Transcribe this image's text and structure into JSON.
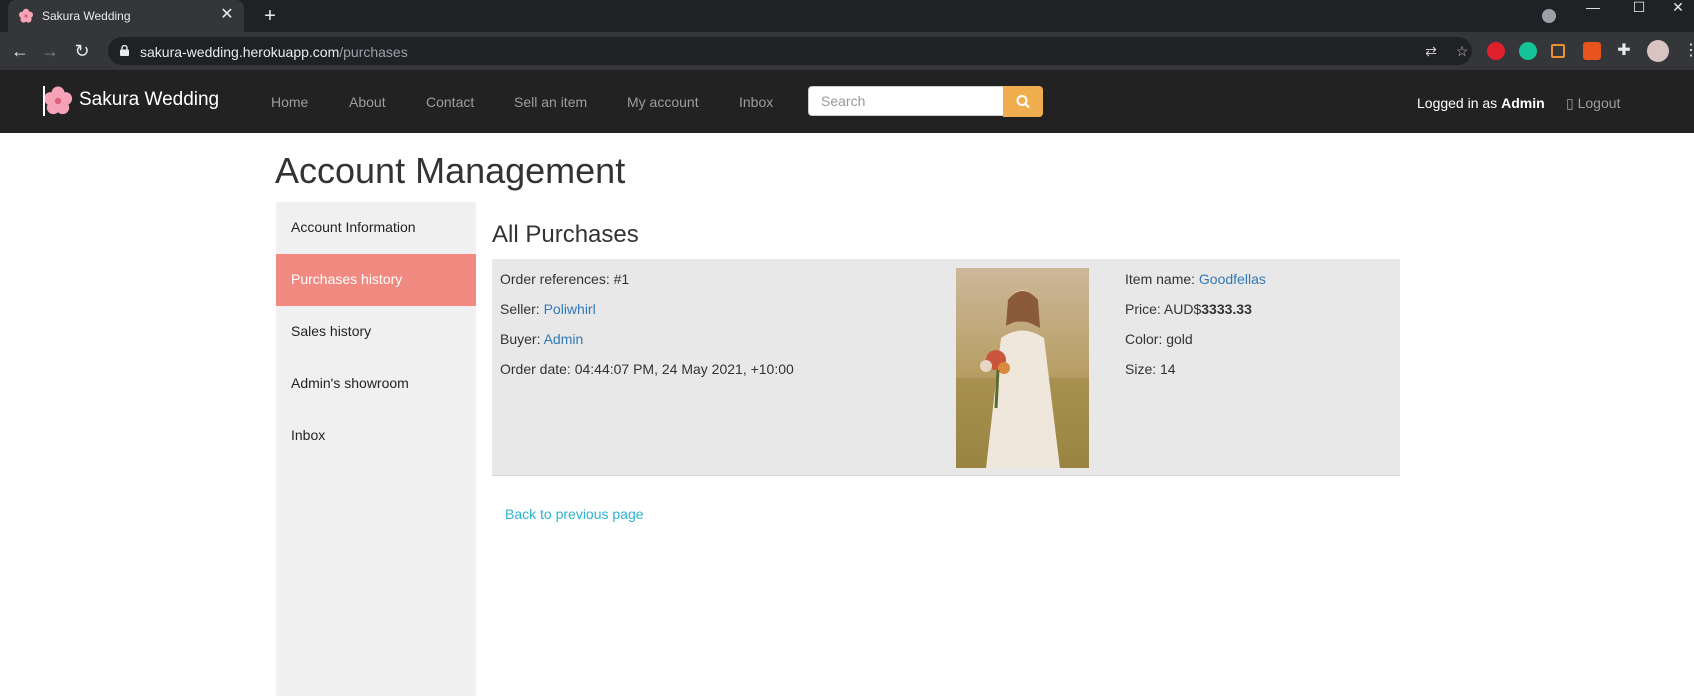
{
  "browser": {
    "tab_title": "Sakura Wedding",
    "url_host": "sakura-wedding.herokuapp.com",
    "url_path": "/purchases",
    "new_tab_icon": "plus-icon",
    "close_tab_icon": "close-icon"
  },
  "navbar": {
    "brand": "Sakura Wedding",
    "links": [
      "Home",
      "About",
      "Contact",
      "Sell an item",
      "My account",
      "Inbox"
    ],
    "search_placeholder": "Search",
    "logged_in_prefix": "Logged in as ",
    "logged_in_user": "Admin",
    "logout_label": "Logout",
    "accent": "#f0ad4e",
    "background": "#222222"
  },
  "page": {
    "title": "Account Management",
    "sidebar": [
      "Account Information",
      "Purchases history",
      "Sales history",
      "Admin's showroom",
      "Inbox"
    ],
    "sidebar_active": "Purchases history",
    "section_title": "All Purchases",
    "back_link": "Back to previous page"
  },
  "purchase": {
    "order_ref_label": "Order references: ",
    "order_ref": "#1",
    "seller_label": "Seller: ",
    "seller": "Poliwhirl",
    "buyer_label": "Buyer: ",
    "buyer": "Admin",
    "date_label": "Order date: ",
    "date": "04:44:07 PM, 24 May 2021, +10:00",
    "item_label": "Item name: ",
    "item": "Goodfellas",
    "price_label": "Price: AUD$",
    "price": "3333.33",
    "color_label": "Color: ",
    "color": "gold",
    "size_label": "Size: ",
    "size": "14"
  }
}
